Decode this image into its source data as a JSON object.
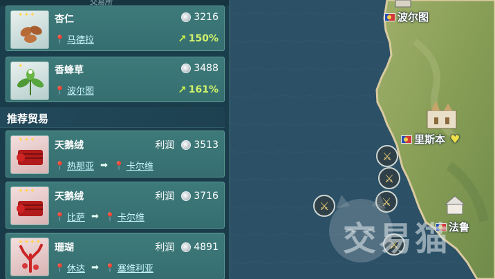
{
  "top_strip_text": "交易所",
  "goods": [
    {
      "name": "杏仁",
      "location": "马德拉",
      "price": "3216",
      "change": "150%",
      "thumb_icon": "almond-icon",
      "stars": 3
    },
    {
      "name": "香蜂草",
      "location": "波尔图",
      "price": "3488",
      "change": "161%",
      "thumb_icon": "herb-icon",
      "stars": 1
    }
  ],
  "section_title": "推荐贸易",
  "recommended": [
    {
      "name": "天鹅绒",
      "profit_label": "利润",
      "profit": "3513",
      "from": "热那亚",
      "to": "卡尔维",
      "thumb_icon": "velvet-icon",
      "stars": 3
    },
    {
      "name": "天鹅绒",
      "profit_label": "利润",
      "profit": "3716",
      "from": "比萨",
      "to": "卡尔维",
      "thumb_icon": "velvet-icon",
      "stars": 3
    },
    {
      "name": "珊瑚",
      "profit_label": "利润",
      "profit": "4891",
      "from": "休达",
      "to": "塞维利亚",
      "thumb_icon": "coral-icon",
      "stars": 4
    }
  ],
  "map": {
    "cities": [
      {
        "name": "波尔图",
        "icon": "port-flag-icon"
      },
      {
        "name": "里斯本",
        "icon": "capital-flag-icon"
      },
      {
        "name": "法鲁",
        "icon": "town-flag-icon"
      }
    ],
    "battle_markers": 5,
    "watermark_text": "交易猫"
  },
  "colors": {
    "panel_bg": "#1b3f4d",
    "card_bg": "#3e7a7a",
    "sea": "#2c5066",
    "land": "#8da35a",
    "trend_up": "#c7f04a"
  }
}
